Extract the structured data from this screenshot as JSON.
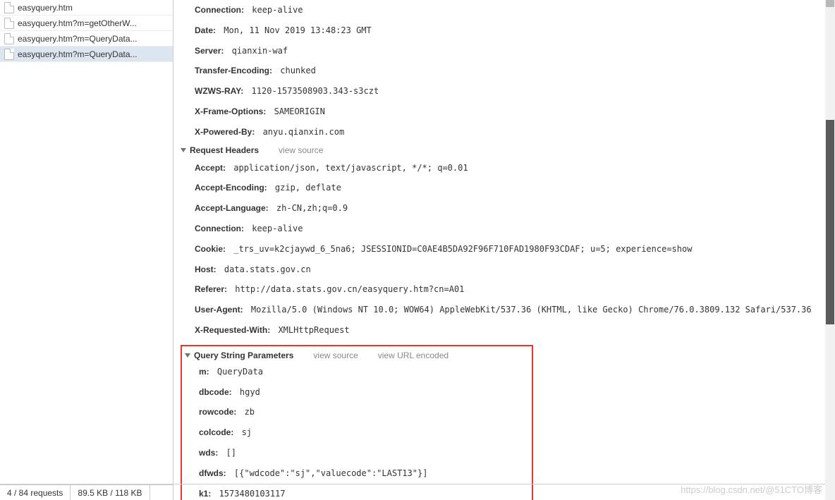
{
  "sidebar": {
    "items": [
      {
        "name": "easyquery.htm"
      },
      {
        "name": "easyquery.htm?m=getOtherW..."
      },
      {
        "name": "easyquery.htm?m=QueryData..."
      },
      {
        "name": "easyquery.htm?m=QueryData..."
      }
    ]
  },
  "response_headers": [
    {
      "name": "Connection:",
      "value": "keep-alive"
    },
    {
      "name": "Date:",
      "value": "Mon, 11 Nov 2019 13:48:23 GMT"
    },
    {
      "name": "Server:",
      "value": "qianxin-waf"
    },
    {
      "name": "Transfer-Encoding:",
      "value": "chunked"
    },
    {
      "name": "WZWS-RAY:",
      "value": "1120-1573508903.343-s3czt"
    },
    {
      "name": "X-Frame-Options:",
      "value": "SAMEORIGIN"
    },
    {
      "name": "X-Powered-By:",
      "value": "anyu.qianxin.com"
    }
  ],
  "request_headers_section": {
    "title": "Request Headers",
    "view_source": "view source"
  },
  "request_headers": [
    {
      "name": "Accept:",
      "value": "application/json, text/javascript, */*; q=0.01"
    },
    {
      "name": "Accept-Encoding:",
      "value": "gzip, deflate"
    },
    {
      "name": "Accept-Language:",
      "value": "zh-CN,zh;q=0.9"
    },
    {
      "name": "Connection:",
      "value": "keep-alive"
    },
    {
      "name": "Cookie:",
      "value": "_trs_uv=k2cjaywd_6_5na6; JSESSIONID=C0AE4B5DA92F96F710FAD1980F93CDAF; u=5; experience=show"
    },
    {
      "name": "Host:",
      "value": "data.stats.gov.cn"
    },
    {
      "name": "Referer:",
      "value": "http://data.stats.gov.cn/easyquery.htm?cn=A01"
    },
    {
      "name": "User-Agent:",
      "value": "Mozilla/5.0 (Windows NT 10.0; WOW64) AppleWebKit/537.36 (KHTML, like Gecko) Chrome/76.0.3809.132 Safari/537.36"
    },
    {
      "name": "X-Requested-With:",
      "value": "XMLHttpRequest"
    }
  ],
  "query_string_section": {
    "title": "Query String Parameters",
    "view_source": "view source",
    "view_url_encoded": "view URL encoded"
  },
  "query_string": [
    {
      "name": "m:",
      "value": "QueryData"
    },
    {
      "name": "dbcode:",
      "value": "hgyd"
    },
    {
      "name": "rowcode:",
      "value": "zb"
    },
    {
      "name": "colcode:",
      "value": "sj"
    },
    {
      "name": "wds:",
      "value": "[]"
    },
    {
      "name": "dfwds:",
      "value": "[{\"wdcode\":\"sj\",\"valuecode\":\"LAST13\"}]"
    },
    {
      "name": "k1:",
      "value": "1573480103117"
    }
  ],
  "status": {
    "requests": "4 / 84 requests",
    "transferred": "89.5 KB / 118 KB"
  },
  "watermark": "https://blog.csdn.net/@51CTO博客"
}
